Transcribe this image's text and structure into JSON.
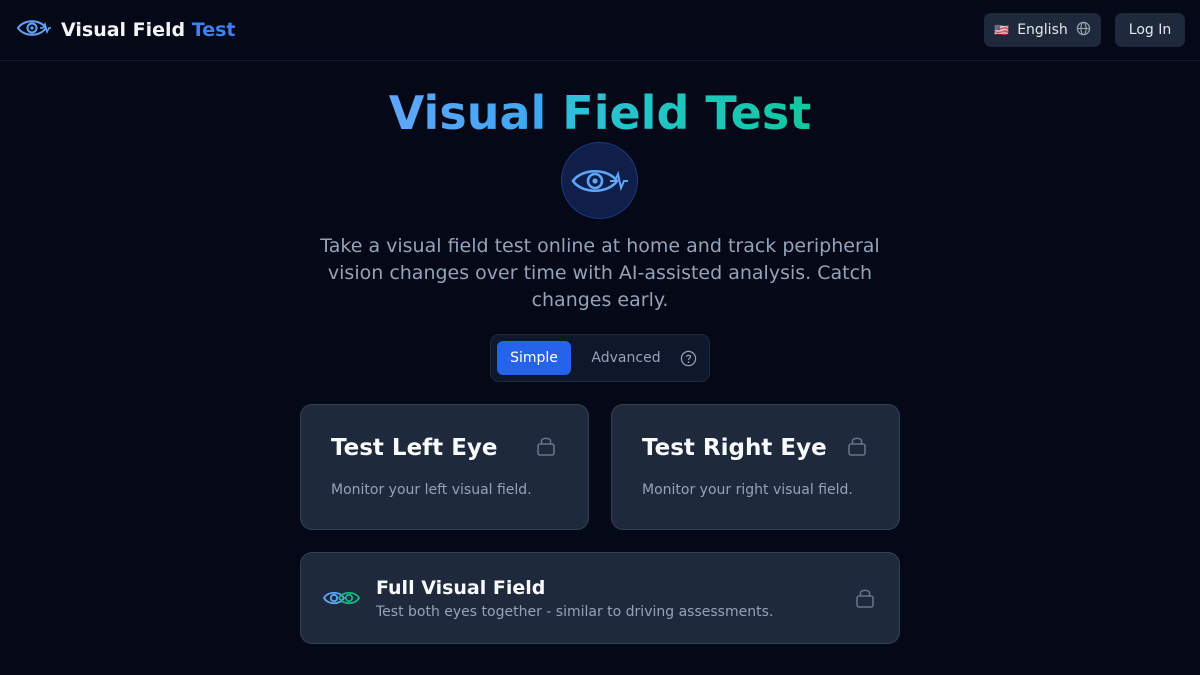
{
  "header": {
    "brand_main": "Visual Field",
    "brand_accent": "Test",
    "language": {
      "flag": "🇺🇸",
      "label": "English"
    },
    "login_label": "Log In"
  },
  "hero": {
    "title_part1": "Visual",
    "title_part2": "Field Test",
    "subtitle": "Take a visual field test online at home and track peripheral vision changes over time with AI-assisted analysis. Catch changes early."
  },
  "mode": {
    "options": [
      "Simple",
      "Advanced"
    ],
    "selected": "Simple"
  },
  "cards": [
    {
      "title": "Test Left Eye",
      "description": "Monitor your left visual field.",
      "locked": true
    },
    {
      "title": "Test Right Eye",
      "description": "Monitor your right visual field.",
      "locked": true
    }
  ],
  "full_card": {
    "title": "Full Visual Field",
    "description": "Test both eyes together - similar to driving assessments.",
    "locked": true
  },
  "colors": {
    "background": "#050816",
    "accent": "#2563eb",
    "card": "#1e293b",
    "gradient_start": "#60a5fa",
    "gradient_end": "#10b981"
  },
  "icons": {
    "brand": "eye-pulse-icon",
    "hero": "eye-pulse-icon",
    "language": "globe-icon",
    "help": "question-circle-icon",
    "lock": "lock-icon",
    "full": "two-eyes-icon"
  }
}
